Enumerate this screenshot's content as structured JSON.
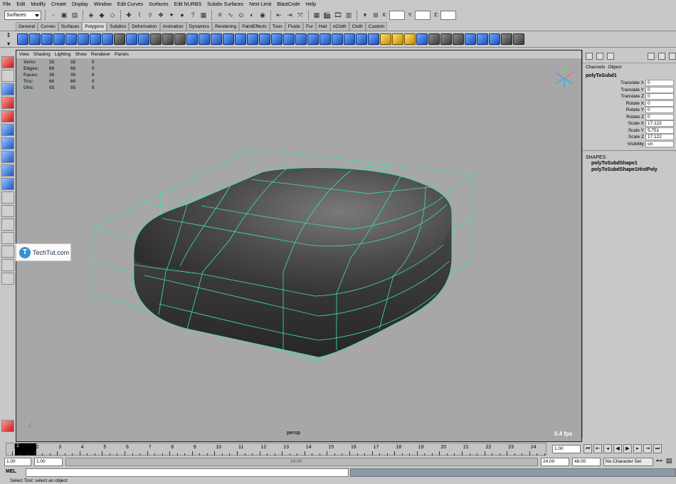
{
  "menu": [
    "File",
    "Edit",
    "Modify",
    "Create",
    "Display",
    "Window",
    "Edit Curves",
    "Surfaces",
    "Edit NURBS",
    "Subdiv Surfaces",
    "Next Limit",
    "BlastCode",
    "Help"
  ],
  "status_line": {
    "menu_set": "Surfaces",
    "x_label": "X:",
    "y_label": "Y:",
    "z_label": "Z:",
    "icons": [
      "new-scene-icon",
      "open-scene-icon",
      "save-scene-icon",
      "select-hierarchy-icon",
      "select-object-icon",
      "select-component-icon",
      "snap-grid-icon",
      "snap-curve-icon",
      "snap-point-icon",
      "snap-view-plane-icon",
      "history-icon",
      "render-icon",
      "ipr-render-icon",
      "render-globals-icon"
    ]
  },
  "shelf": {
    "tabs": [
      "General",
      "Curves",
      "Surfaces",
      "Polygons",
      "Subdivs",
      "Deformation",
      "Animation",
      "Dynamics",
      "Rendering",
      "PaintEffects",
      "Toon",
      "Fluids",
      "Fur",
      "Hair",
      "nCloth",
      "Cloth",
      "Custom"
    ],
    "active_tab": "Polygons"
  },
  "viewport": {
    "menu": [
      "View",
      "Shading",
      "Lighting",
      "Show",
      "Renderer",
      "Panels"
    ],
    "hud": [
      {
        "label": "Verts:",
        "a": "32",
        "b": "32",
        "c": "0"
      },
      {
        "label": "Edges:",
        "a": "60",
        "b": "60",
        "c": "0"
      },
      {
        "label": "Faces:",
        "a": "30",
        "b": "30",
        "c": "0"
      },
      {
        "label": "Tris:",
        "a": "60",
        "b": "60",
        "c": "0"
      },
      {
        "label": "UVs:",
        "a": "55",
        "b": "55",
        "c": "0"
      }
    ],
    "camera": "persp",
    "fps": "0.4 fps",
    "accent_wire": "#3fe0b0",
    "mesh_color": "#4a4a4a"
  },
  "watermark": {
    "text": "TechTut.com",
    "logo": "T"
  },
  "channel_box": {
    "menu": [
      "Channels",
      "Object"
    ],
    "node": "polyToSubd1",
    "attributes": [
      {
        "name": "Translate X",
        "value": "0"
      },
      {
        "name": "Translate Y",
        "value": "0"
      },
      {
        "name": "Translate Z",
        "value": "0"
      },
      {
        "name": "Rotate X",
        "value": "0"
      },
      {
        "name": "Rotate Y",
        "value": "0"
      },
      {
        "name": "Rotate Z",
        "value": "0"
      },
      {
        "name": "Scale X",
        "value": "17.122"
      },
      {
        "name": "Scale Y",
        "value": "5.751"
      },
      {
        "name": "Scale Z",
        "value": "17.122"
      },
      {
        "name": "Visibility",
        "value": "on"
      }
    ],
    "shapes_header": "SHAPES",
    "shapes": [
      "polyToSubdShape1",
      "polyToSubdShape1HistPoly"
    ]
  },
  "time_slider": {
    "ticks": [
      "1",
      "2",
      "3",
      "4",
      "5",
      "6",
      "7",
      "8",
      "9",
      "10",
      "11",
      "12",
      "13",
      "14",
      "15",
      "16",
      "17",
      "18",
      "19",
      "20",
      "21",
      "22",
      "23",
      "24"
    ],
    "current_frame": "1",
    "current_field": "1.00",
    "playback_icons": [
      "go-to-start-icon",
      "step-back-key-icon",
      "step-back-frame-icon",
      "play-backward-icon",
      "play-forward-icon",
      "step-forward-frame-icon",
      "step-forward-key-icon",
      "go-to-end-icon"
    ]
  },
  "range_slider": {
    "start": "1.00",
    "start_inner": "1.00",
    "end_inner": "24.00",
    "end": "48.00",
    "mid_label": "24.00",
    "character_set": "No Character Set"
  },
  "command_line": {
    "label": "MEL"
  },
  "help_line": "Select Tool: select an object"
}
